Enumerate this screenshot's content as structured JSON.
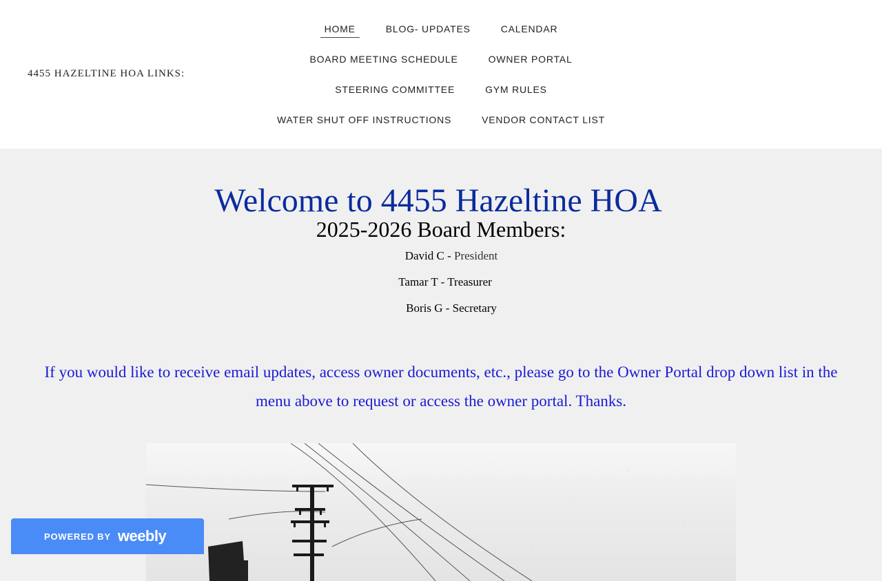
{
  "header": {
    "site_title": "4455 HAZELTINE HOA LINKS:",
    "nav_rows": [
      [
        {
          "label": "HOME",
          "active": true
        },
        {
          "label": "BLOG- UPDATES"
        },
        {
          "label": "CALENDAR"
        }
      ],
      [
        {
          "label": "BOARD MEETING SCHEDULE"
        },
        {
          "label": "OWNER PORTAL"
        }
      ],
      [
        {
          "label": "STEERING COMMITTEE"
        },
        {
          "label": "GYM RULES"
        }
      ],
      [
        {
          "label": "WATER SHUT OFF INSTRUCTIONS"
        },
        {
          "label": "VENDOR CONTACT LIST"
        }
      ]
    ]
  },
  "main": {
    "welcome": "Welcome to 4455 Hazeltine HOA",
    "board_heading": "2025-2026 Board Members:",
    "members": [
      {
        "name": "David C - ",
        "role": "President"
      },
      {
        "name": "Tamar T - ",
        "role": "Treasurer"
      },
      {
        "name": "Boris G - ",
        "role": "Secretary"
      }
    ],
    "info_text": "If you would like to receive email updates, access owner documents, etc., please go to the Owner Portal drop down list in the menu above to request or access the owner portal.  Thanks."
  },
  "badge": {
    "powered": "POWERED BY",
    "brand": "weebly"
  },
  "colors": {
    "heading_blue": "#0a2b9e",
    "info_blue": "#1a1ad6",
    "badge_blue": "#4a8cf7"
  }
}
